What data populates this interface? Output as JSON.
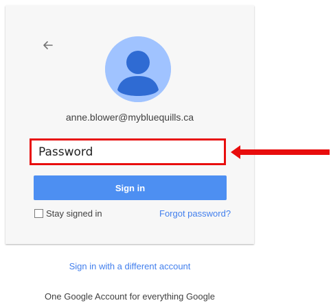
{
  "account": {
    "email": "anne.blower@mybluequills.ca"
  },
  "form": {
    "password_placeholder": "Password",
    "signin_label": "Sign in",
    "stay_signed_in_label": "Stay signed in",
    "stay_signed_in_checked": false,
    "forgot_password_label": "Forgot password?"
  },
  "footer": {
    "different_account_label": "Sign in with a different account",
    "tagline": "One Google Account for everything Google"
  },
  "icons": {
    "back": "arrow-left-icon",
    "avatar": "person-avatar-icon",
    "annotation": "red-arrow-annotation"
  },
  "colors": {
    "accent_blue": "#4d8ff2",
    "link_blue": "#427fed",
    "highlight_red": "#e80d0d",
    "avatar_bg": "#a0c3ff",
    "avatar_fg": "#2f6bd3"
  }
}
